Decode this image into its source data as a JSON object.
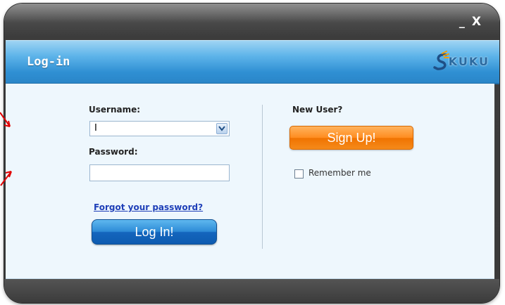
{
  "window": {
    "minimize_glyph": "_",
    "close_glyph": "X"
  },
  "header": {
    "title": "Log-in",
    "logo_text": "KUKU"
  },
  "form": {
    "username_label": "Username:",
    "username_value": "I",
    "password_label": "Password:",
    "password_value": "",
    "forgot_link": "Forgot your password?",
    "login_button": "Log In!",
    "new_user_label": "New User?",
    "signup_button": "Sign Up!",
    "remember_label": "Remember me",
    "remember_checked": false
  },
  "colors": {
    "header_blue": "#2f8fd3",
    "content_bg": "#eef7fd",
    "login_blue": "#1465bd",
    "signup_orange": "#ff8c1f",
    "link_blue": "#1e3fb8",
    "annotation_red": "#e00000",
    "chrome_dark": "#3a3a3a"
  },
  "icons": {
    "minimize": "minimize-icon",
    "close": "close-icon",
    "logo": "skuku-logo-icon",
    "dropdown": "chevron-down-icon",
    "annotation": "red-arrow-icon"
  }
}
